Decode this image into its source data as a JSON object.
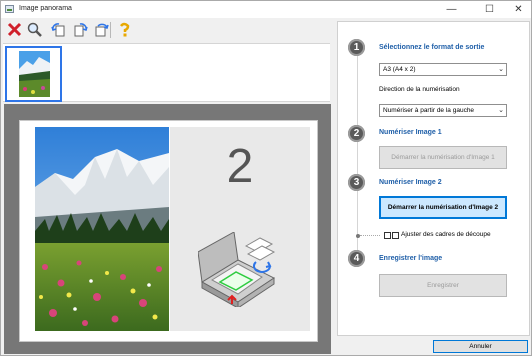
{
  "window": {
    "title": "Image panorama"
  },
  "toolbar": {
    "buttons": [
      "delete-icon",
      "zoom-icon",
      "rotate-left-icon",
      "rotate-right-icon",
      "rotate-180-icon",
      "help-icon"
    ]
  },
  "preview": {
    "page_number": "2"
  },
  "steps": [
    {
      "number": "1",
      "title": "Sélectionnez le format de sortie"
    },
    {
      "number": "2",
      "title": "Numériser Image 1"
    },
    {
      "number": "3",
      "title": "Numériser Image 2"
    },
    {
      "number": "4",
      "title": "Enregistrer l'image"
    }
  ],
  "form": {
    "output_format": "A3 (A4 x 2)",
    "scan_direction_label": "Direction de la numérisation",
    "scan_direction": "Numériser à partir de la gauche",
    "scan_image1_btn": "Démarrer la numérisation d'Image 1",
    "scan_image2_btn": "Démarrer la numérisation d'Image 2",
    "crop_label": "Ajuster des cadres de découpe",
    "save_btn": "Enregistrer"
  },
  "footer": {
    "cancel": "Annuler"
  },
  "colors": {
    "accent": "#1f5fa8",
    "selection": "#2e75e8",
    "active_button": "#cce8ff",
    "preview_bg": "#777777"
  }
}
